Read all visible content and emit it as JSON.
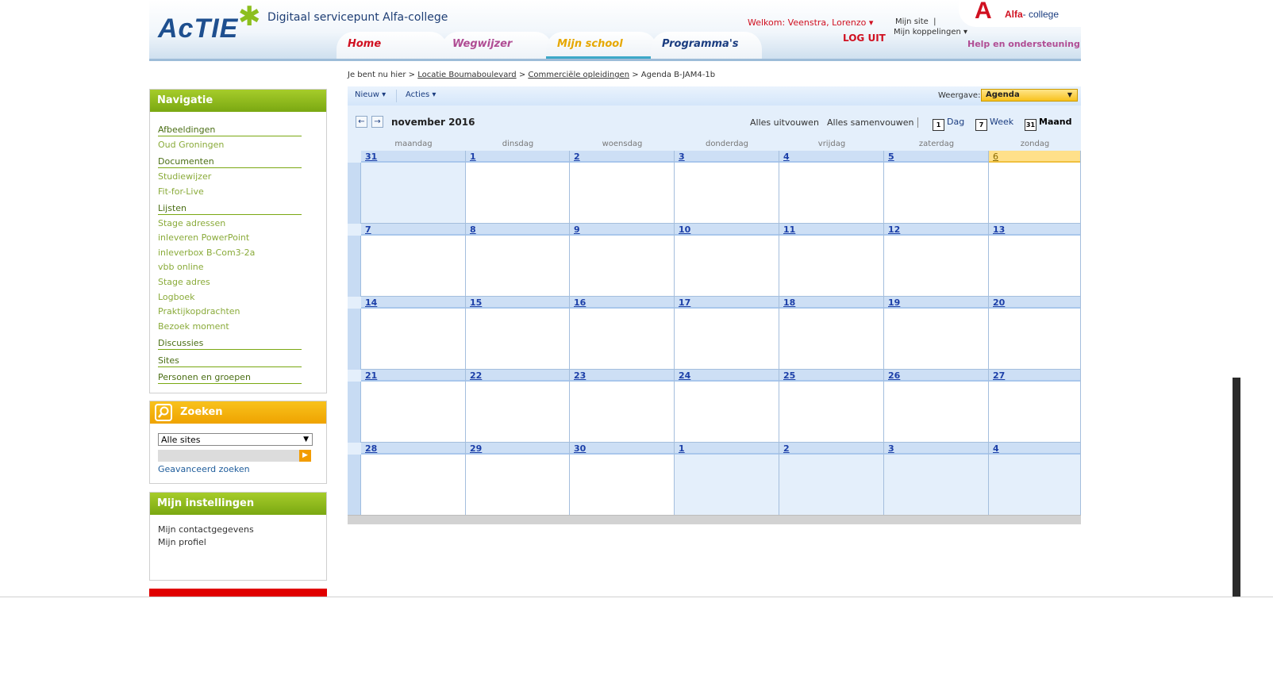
{
  "header": {
    "logo": "AcTIE",
    "portal_title": "Digitaal servicepunt Alfa-college",
    "tabs": [
      "Home",
      "Wegwijzer",
      "Mijn school",
      "Programma's"
    ],
    "welcome": "Welkom: Veenstra, Lorenzo",
    "logout": "LOG UIT",
    "mijn_site": "Mijn site",
    "mijn_koppelingen": "Mijn koppelingen",
    "alfa_brand": "Alfa",
    "alfa_suffix": "- college",
    "help": "Help en ondersteuning"
  },
  "breadcrumb": {
    "prefix": "Je bent nu hier >",
    "link1": "Locatie Boumaboulevard",
    "sep": ">",
    "link2": "Commerciële opleidingen",
    "current": "> Agenda B-JAM4-1b"
  },
  "nav": {
    "title": "Navigatie",
    "afbeeldingen": "Afbeeldingen",
    "oud_groningen": "Oud Groningen",
    "documenten": "Documenten",
    "studiewijzer": "Studiewijzer",
    "fit_for_live": "Fit-for-Live",
    "lijsten": "Lijsten",
    "lijsten_items": [
      "Stage adressen",
      "inleveren PowerPoint",
      "inleverbox B-Com3-2a",
      "vbb online",
      "Stage adres",
      "Logboek",
      "Praktijkopdrachten",
      "Bezoek moment"
    ],
    "discussies": "Discussies",
    "sites": "Sites",
    "personen": "Personen en groepen"
  },
  "search": {
    "title": "Zoeken",
    "scope": "Alle sites",
    "advanced": "Geavanceerd zoeken"
  },
  "settings": {
    "title": "Mijn instellingen",
    "contact": "Mijn contactgegevens",
    "profile": "Mijn profiel"
  },
  "toolbar": {
    "new": "Nieuw",
    "actions": "Acties",
    "view_label": "Weergave:",
    "view_value": "Agenda"
  },
  "calendar": {
    "month": "november 2016",
    "expand_all": "Alles uitvouwen",
    "collapse_all": "Alles samenvouwen",
    "view_day": "Dag",
    "view_week": "Week",
    "view_month": "Maand",
    "view_day_icon": "1",
    "view_week_icon": "7",
    "view_month_icon": "31",
    "weekdays": [
      "maandag",
      "dinsdag",
      "woensdag",
      "donderdag",
      "vrijdag",
      "zaterdag",
      "zondag"
    ],
    "weeks": [
      [
        "31",
        "1",
        "2",
        "3",
        "4",
        "5",
        "6"
      ],
      [
        "7",
        "8",
        "9",
        "10",
        "11",
        "12",
        "13"
      ],
      [
        "14",
        "15",
        "16",
        "17",
        "18",
        "19",
        "20"
      ],
      [
        "21",
        "22",
        "23",
        "24",
        "25",
        "26",
        "27"
      ],
      [
        "28",
        "29",
        "30",
        "1",
        "2",
        "3",
        "4"
      ]
    ],
    "out_of_month": [
      [
        0,
        0
      ],
      [
        4,
        3
      ],
      [
        4,
        4
      ],
      [
        4,
        5
      ],
      [
        4,
        6
      ]
    ],
    "today": [
      0,
      6
    ]
  }
}
